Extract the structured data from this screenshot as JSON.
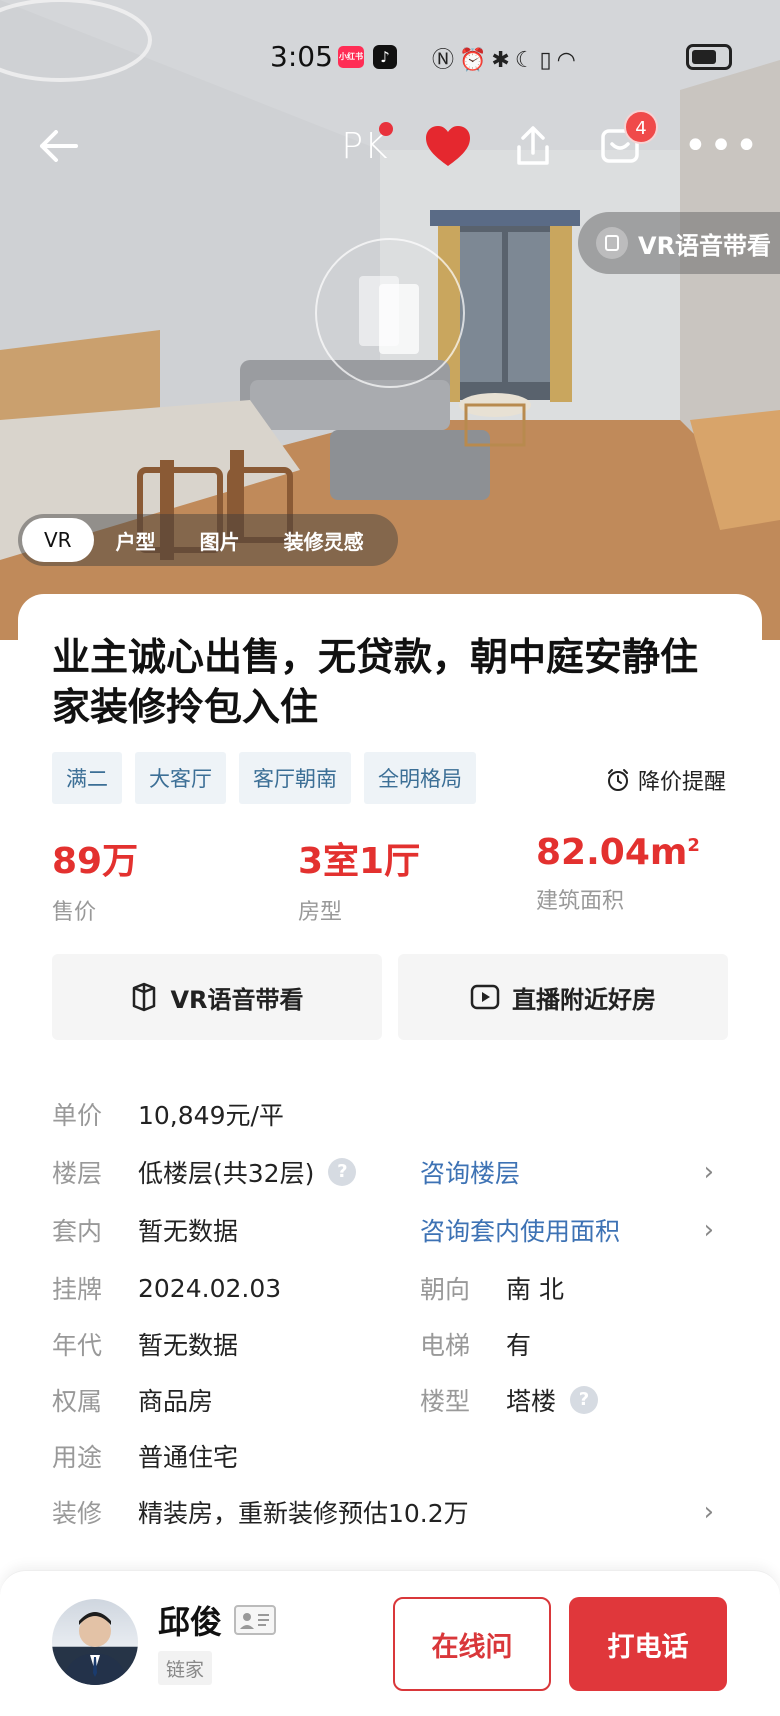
{
  "status_bar": {
    "time": "3:05",
    "app_badge": "小红书"
  },
  "header": {
    "pk_label": "PK",
    "message_count": "4",
    "vr_voice_label": "VR语音带看"
  },
  "media_tabs": [
    {
      "label": "VR",
      "active": true
    },
    {
      "label": "户型",
      "active": false
    },
    {
      "label": "图片",
      "active": false
    },
    {
      "label": "装修灵感",
      "active": false
    }
  ],
  "listing": {
    "title": "业主诚心出售，无贷款，朝中庭安静住家装修拎包入住",
    "tags": [
      "满二",
      "大客厅",
      "客厅朝南",
      "全明格局"
    ],
    "price_alert": "降价提醒",
    "kpis": [
      {
        "value": "89万",
        "label": "售价"
      },
      {
        "value": "3室1厅",
        "label": "房型"
      },
      {
        "value": "82.04m",
        "sup": "2",
        "label": "建筑面积"
      }
    ],
    "actions": {
      "vr": "VR语音带看",
      "live": "直播附近好房"
    }
  },
  "details": {
    "unit_price": {
      "label": "单价",
      "value": "10,849元/平"
    },
    "floor": {
      "label": "楼层",
      "value": "低楼层(共32层)",
      "help": "?",
      "link": "咨询楼层"
    },
    "inner": {
      "label": "套内",
      "value": "暂无数据",
      "link": "咨询套内使用面积"
    },
    "listed": {
      "label": "挂牌",
      "value": "2024.02.03"
    },
    "orientation": {
      "label": "朝向",
      "value": "南 北"
    },
    "year": {
      "label": "年代",
      "value": "暂无数据"
    },
    "elevator": {
      "label": "电梯",
      "value": "有"
    },
    "ownership": {
      "label": "权属",
      "value": "商品房"
    },
    "building_type": {
      "label": "楼型",
      "value": "塔楼",
      "help": "?"
    },
    "usage": {
      "label": "用途",
      "value": "普通住宅"
    },
    "decoration": {
      "label": "装修",
      "value": "精装房，重新装修预估10.2万"
    }
  },
  "agent": {
    "name": "邱俊",
    "company": "链家",
    "chat_label": "在线问",
    "call_label": "打电话"
  },
  "colors": {
    "accent_red": "#e3312f",
    "link_blue": "#3d72b4",
    "tag_bg": "#eef3f7"
  }
}
